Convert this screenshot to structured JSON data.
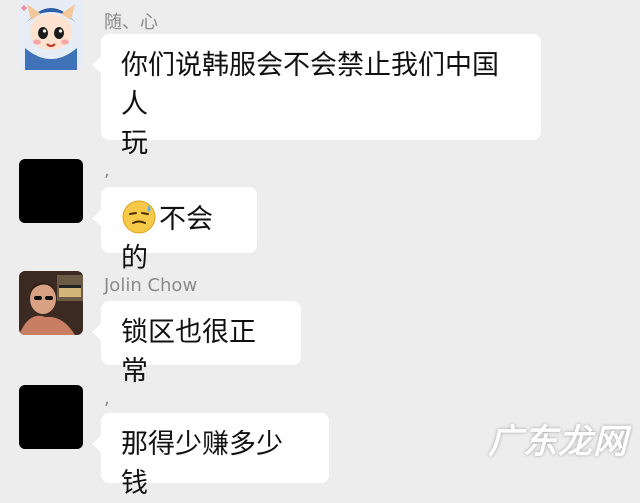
{
  "messages": [
    {
      "sender": "随、心",
      "text": "你们说韩服会不会禁止我们中国人玩",
      "line1": "你们说韩服会不会禁止我们中国人",
      "line2": "玩",
      "avatar": "cartoon-boy-avatar"
    },
    {
      "sender": ",",
      "text": "不会的",
      "emoji": "sweat-smile-emoji",
      "avatar": "black-avatar"
    },
    {
      "sender": "Jolin Chow",
      "text": "锁区也很正常",
      "avatar": "photo-avatar"
    },
    {
      "sender": ",",
      "text": "那得少赚多少钱",
      "avatar": "black-avatar"
    }
  ],
  "watermark": "广东龙网",
  "colors": {
    "background": "#ededed",
    "bubble": "#ffffff",
    "sender_name": "#8a8a8a"
  }
}
